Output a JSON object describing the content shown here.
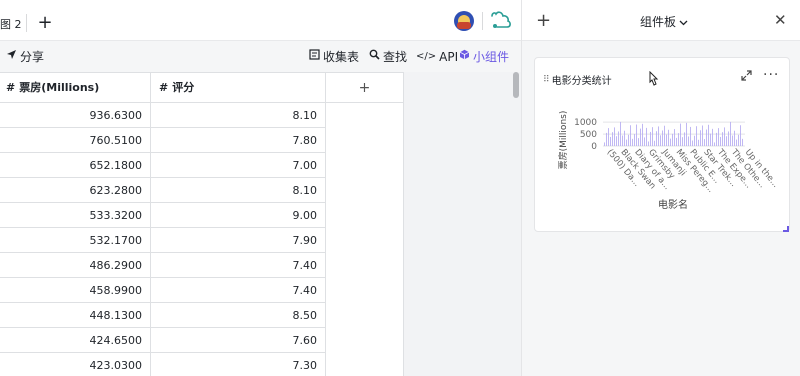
{
  "tab": {
    "label": "图 2",
    "add_label": "+"
  },
  "toolbar": {
    "share": "分享",
    "form": "收集表",
    "find": "查找",
    "api": "API",
    "widgets": "小组件"
  },
  "grid": {
    "columns": [
      {
        "label": "票房(Millions)"
      },
      {
        "label": "评分"
      }
    ],
    "add_column": "+",
    "rows": [
      {
        "box_office": "936.6300",
        "rating": "8.10"
      },
      {
        "box_office": "760.5100",
        "rating": "7.80"
      },
      {
        "box_office": "652.1800",
        "rating": "7.00"
      },
      {
        "box_office": "623.2800",
        "rating": "8.10"
      },
      {
        "box_office": "533.3200",
        "rating": "9.00"
      },
      {
        "box_office": "532.1700",
        "rating": "7.90"
      },
      {
        "box_office": "486.2900",
        "rating": "7.40"
      },
      {
        "box_office": "458.9900",
        "rating": "7.40"
      },
      {
        "box_office": "448.1300",
        "rating": "8.50"
      },
      {
        "box_office": "424.6500",
        "rating": "7.60"
      },
      {
        "box_office": "423.0300",
        "rating": "7.30"
      }
    ]
  },
  "panel": {
    "add": "+",
    "title": "组件板",
    "close": "✕"
  },
  "widget": {
    "title": "电影分类统计"
  },
  "chart_data": {
    "type": "bar",
    "ylabel": "票房(Millions)",
    "xlabel": "电影名",
    "yticks": [
      "1000",
      "500",
      "0"
    ],
    "ylim": [
      0,
      1300
    ],
    "categories": [
      "(500) Da...",
      "Black Swan",
      "Diary of a...",
      "Grimsby",
      "Jumanji",
      "Miss Pereg...",
      "Public E...",
      "Star Trek...",
      "The Expe...",
      "The Othe...",
      "Up in the..."
    ],
    "bar_color": "#b9b0f2"
  },
  "colors": {
    "accent": "#6b59e3",
    "bar": "#b9b0f2"
  }
}
